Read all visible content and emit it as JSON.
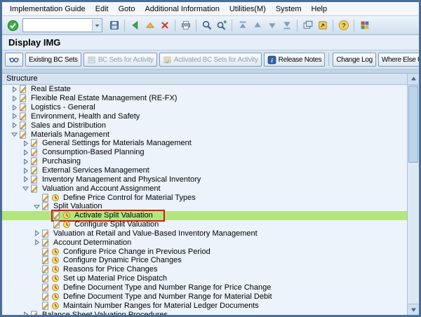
{
  "colors": {
    "frame": "#4a6e96",
    "highlight_green": "#b3e67d",
    "annotation_red": "#df1414",
    "tree_background": "#edf3fb"
  },
  "menu_bar": {
    "items": [
      {
        "label": "Implementation Guide"
      },
      {
        "label": "Edit"
      },
      {
        "label": "Goto"
      },
      {
        "label": "Additional Information"
      },
      {
        "label": "Utilities(M)"
      },
      {
        "label": "System"
      },
      {
        "label": "Help"
      }
    ]
  },
  "toolbar": {
    "enter_icon": "enter-icon",
    "command_field": {
      "value": ""
    },
    "icons": [
      "save-icon",
      "sep",
      "back-icon",
      "exit-icon",
      "cancel-icon",
      "sep",
      "print-icon",
      "sep",
      "find-icon",
      "find-next-icon",
      "sep",
      "first-page-icon",
      "page-up-icon",
      "page-down-icon",
      "last-page-icon",
      "sep",
      "new-session-icon",
      "create-shortcut-icon",
      "sep",
      "help-icon",
      "sep",
      "customize-layout-icon"
    ]
  },
  "page": {
    "title": "Display IMG"
  },
  "app_toolbar": {
    "buttons": [
      {
        "id": "display-change-toggle",
        "label": "",
        "icon": "glasses-icon",
        "enabled": true
      },
      {
        "id": "existing-bc-sets",
        "label": "Existing BC Sets",
        "icon": null,
        "enabled": true
      },
      {
        "id": "bc-sets-for-activity",
        "label": "BC Sets for Activity",
        "icon": "bc-sets-icon",
        "enabled": false
      },
      {
        "id": "activated-bc-sets-for-activity",
        "label": "Activated BC Sets for Activity",
        "icon": "bc-sets-activated-icon",
        "enabled": false
      },
      {
        "id": "release-notes",
        "label": "Release Notes",
        "icon": "info-icon",
        "enabled": true
      },
      {
        "id": "change-log",
        "label": "Change Log",
        "icon": null,
        "enabled": true,
        "separator_before": true
      },
      {
        "id": "where-else-used",
        "label": "Where Else Used",
        "icon": null,
        "enabled": true
      }
    ]
  },
  "structure_panel": {
    "header": "Structure",
    "scrollbar": {
      "up_icon": "scroll-up-icon",
      "down_icon": "scroll-down-icon"
    },
    "rows": [
      {
        "level": 0,
        "expander": "closed",
        "icons": [
          "img-doc-icon"
        ],
        "label": "Real Estate"
      },
      {
        "level": 0,
        "expander": "closed",
        "icons": [
          "img-doc-icon"
        ],
        "label": "Flexible Real Estate Management (RE-FX)"
      },
      {
        "level": 0,
        "expander": "closed",
        "icons": [
          "img-doc-icon"
        ],
        "label": "Logistics - General"
      },
      {
        "level": 0,
        "expander": "closed",
        "icons": [
          "img-doc-icon"
        ],
        "label": "Environment, Health and Safety"
      },
      {
        "level": 0,
        "expander": "closed",
        "icons": [
          "img-doc-icon"
        ],
        "label": "Sales and Distribution"
      },
      {
        "level": 0,
        "expander": "open",
        "icons": [
          "img-doc-icon"
        ],
        "label": "Materials Management"
      },
      {
        "level": 1,
        "expander": "closed",
        "icons": [
          "img-doc-icon"
        ],
        "label": "General Settings for Materials Management"
      },
      {
        "level": 1,
        "expander": "closed",
        "icons": [
          "img-doc-icon"
        ],
        "label": "Consumption-Based Planning"
      },
      {
        "level": 1,
        "expander": "closed",
        "icons": [
          "img-doc-icon"
        ],
        "label": "Purchasing"
      },
      {
        "level": 1,
        "expander": "closed",
        "icons": [
          "img-doc-icon"
        ],
        "label": "External Services Management"
      },
      {
        "level": 1,
        "expander": "closed",
        "icons": [
          "img-doc-icon"
        ],
        "label": "Inventory Management and Physical Inventory"
      },
      {
        "level": 1,
        "expander": "open",
        "icons": [
          "img-doc-icon"
        ],
        "label": "Valuation and Account Assignment"
      },
      {
        "level": 2,
        "expander": null,
        "icons": [
          "img-doc-icon",
          "img-activity-icon"
        ],
        "label": "Define Price Control for Material Types"
      },
      {
        "level": 2,
        "expander": "open",
        "icons": [
          "img-doc-icon"
        ],
        "label": "Split Valuation"
      },
      {
        "level": 3,
        "expander": null,
        "icons": [
          "img-doc-icon",
          "img-activity-icon"
        ],
        "label": "Activate Split Valuation",
        "highlighted": true,
        "annotated": true
      },
      {
        "level": 3,
        "expander": null,
        "icons": [
          "img-doc-icon",
          "img-activity-icon"
        ],
        "label": "Configure Split Valuation"
      },
      {
        "level": 2,
        "expander": "closed",
        "icons": [
          "img-doc-icon"
        ],
        "label": "Valuation at Retail and Value-Based Inventory Management"
      },
      {
        "level": 2,
        "expander": "closed",
        "icons": [
          "img-doc-icon"
        ],
        "label": "Account Determination"
      },
      {
        "level": 2,
        "expander": null,
        "icons": [
          "img-doc-icon",
          "img-activity-icon"
        ],
        "label": "Configure Price Change in Previous Period"
      },
      {
        "level": 2,
        "expander": null,
        "icons": [
          "img-doc-icon",
          "img-activity-icon"
        ],
        "label": "Configure Dynamic Price Changes"
      },
      {
        "level": 2,
        "expander": null,
        "icons": [
          "img-doc-icon",
          "img-activity-icon"
        ],
        "label": "Reasons for Price Changes"
      },
      {
        "level": 2,
        "expander": null,
        "icons": [
          "img-doc-icon",
          "img-activity-icon"
        ],
        "label": "Set up Material Price Dispatch"
      },
      {
        "level": 2,
        "expander": null,
        "icons": [
          "img-doc-icon",
          "img-activity-icon"
        ],
        "label": "Define Document Type and Number Range for Price Change"
      },
      {
        "level": 2,
        "expander": null,
        "icons": [
          "img-doc-icon",
          "img-activity-icon"
        ],
        "label": "Define Document Type and Number Range for Material Debit"
      },
      {
        "level": 2,
        "expander": null,
        "icons": [
          "img-doc-icon",
          "img-activity-icon"
        ],
        "label": "Maintain Number Ranges for Material Ledger Documents"
      },
      {
        "level": 1,
        "expander": "closed",
        "icons": [
          "img-doc-icon"
        ],
        "label": "Balance Sheet Valuation Procedures"
      }
    ]
  }
}
